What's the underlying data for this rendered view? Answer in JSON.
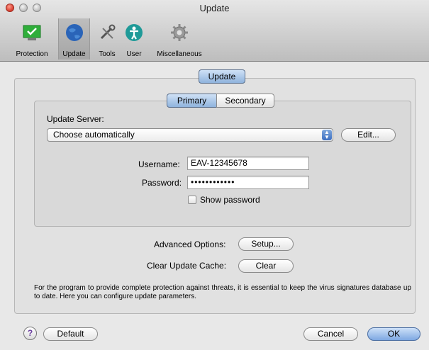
{
  "window": {
    "title": "Update"
  },
  "toolbar": {
    "items": [
      {
        "label": "Protection",
        "icon": "shield-check-icon"
      },
      {
        "label": "Update",
        "icon": "globe-icon"
      },
      {
        "label": "Tools",
        "icon": "tools-icon"
      },
      {
        "label": "User",
        "icon": "user-icon"
      },
      {
        "label": "Miscellaneous",
        "icon": "gear-icon"
      }
    ],
    "selected": "Update"
  },
  "main": {
    "section_tab": "Update",
    "tabs": [
      {
        "label": "Primary"
      },
      {
        "label": "Secondary"
      }
    ],
    "active_tab": "Primary",
    "update_server": {
      "label": "Update Server:",
      "value": "Choose automatically",
      "edit_button": "Edit..."
    },
    "username": {
      "label": "Username:",
      "value": "EAV-12345678"
    },
    "password": {
      "label": "Password:",
      "value": "••••••••••••"
    },
    "show_password": {
      "label": "Show password",
      "checked": false
    },
    "advanced_options": {
      "label": "Advanced Options:",
      "button": "Setup..."
    },
    "clear_cache": {
      "label": "Clear Update Cache:",
      "button": "Clear"
    },
    "description": "For the program to provide complete protection against threats, it is essential to keep the virus signatures database up to date. Here you can configure update parameters."
  },
  "footer": {
    "help": "?",
    "default_button": "Default",
    "cancel_button": "Cancel",
    "ok_button": "OK"
  },
  "colors": {
    "accent": "#8fb3dd",
    "shield": "#2fae3a"
  }
}
